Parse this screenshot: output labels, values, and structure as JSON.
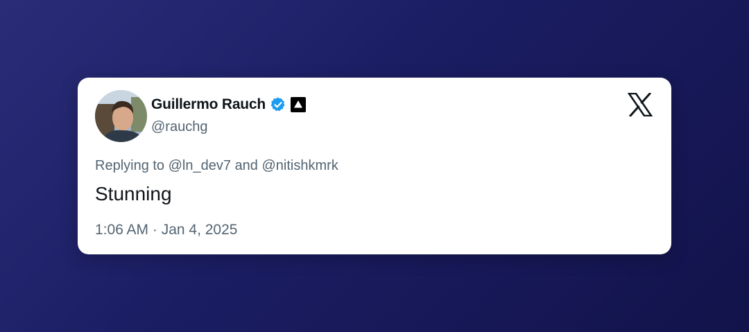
{
  "tweet": {
    "author": {
      "display_name": "Guillermo Rauch",
      "handle": "@rauchg",
      "verified": true,
      "avatar_icon": "profile-photo",
      "affiliate_icon": "vercel-triangle-icon"
    },
    "reply": {
      "prefix": "Replying to",
      "mention_1": "@ln_dev7",
      "connector": "and",
      "mention_2": "@nitishkmrk"
    },
    "text": "Stunning",
    "timestamp": "1:06 AM · Jan 4, 2025",
    "platform_icon": "x-logo-icon"
  },
  "colors": {
    "background_start": "#2a2c78",
    "background_end": "#12134a",
    "card": "#ffffff",
    "primary_text": "#0f1419",
    "secondary_text": "#536471",
    "verified_badge": "#1d9bf0"
  }
}
